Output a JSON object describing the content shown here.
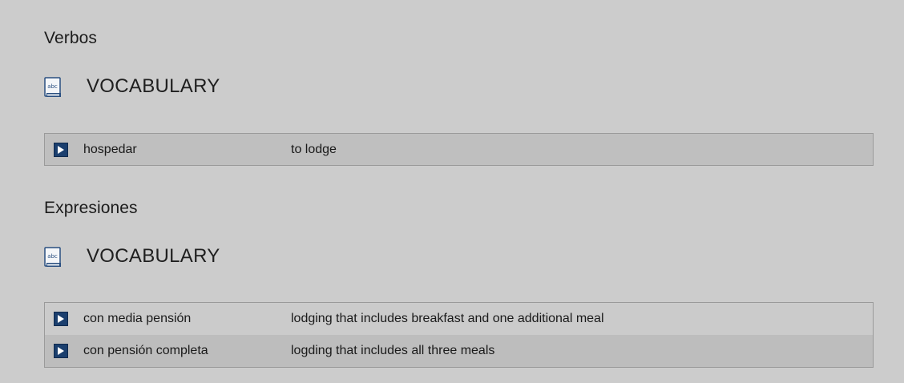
{
  "sections": [
    {
      "heading": "Verbos",
      "vocab_title": "VOCABULARY",
      "icon": "abc-book-icon",
      "entries": [
        {
          "term": "hospedar",
          "definition": "to lodge"
        }
      ]
    },
    {
      "heading": "Expresiones",
      "vocab_title": "VOCABULARY",
      "icon": "abc-book-icon",
      "entries": [
        {
          "term": "con media pensión",
          "definition": "lodging that includes breakfast and one additional meal"
        },
        {
          "term": "con pensión completa",
          "definition": "logding that includes all three meals"
        }
      ]
    }
  ],
  "icon_text": "abc",
  "colors": {
    "background": "#cccccc",
    "play_button": "#1b3f6e",
    "row_alt": "#bdbdbd",
    "border": "#9a9a9a"
  }
}
